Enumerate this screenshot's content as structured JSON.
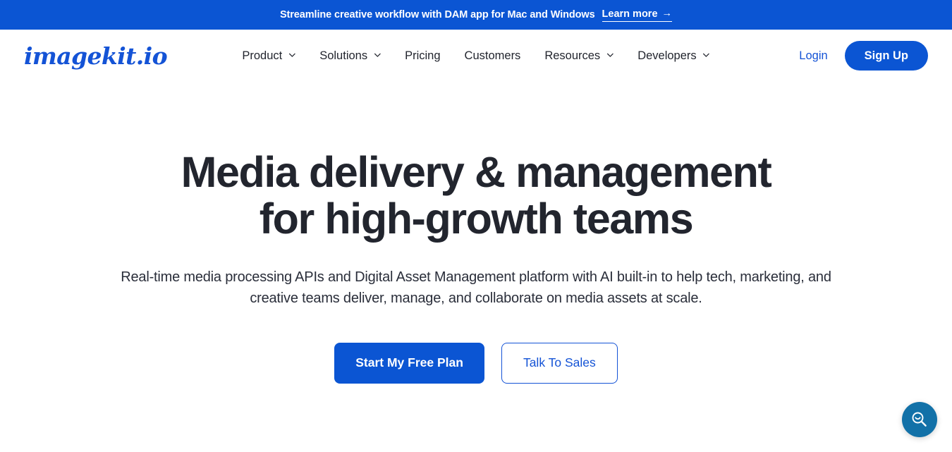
{
  "announcement": {
    "text": "Streamline creative workflow with DAM app for Mac and Windows",
    "link_label": "Learn more",
    "link_arrow": "→",
    "background_color": "#0b55d3"
  },
  "header": {
    "logo": "imagekit.io",
    "nav": [
      {
        "label": "Product",
        "icon": "chevron-down-icon",
        "has_dropdown": true
      },
      {
        "label": "Solutions",
        "icon": "chevron-down-icon",
        "has_dropdown": true
      },
      {
        "label": "Pricing",
        "icon": "",
        "has_dropdown": false
      },
      {
        "label": "Customers",
        "icon": "",
        "has_dropdown": false
      },
      {
        "label": "Resources",
        "icon": "chevron-down-icon",
        "has_dropdown": true
      },
      {
        "label": "Developers",
        "icon": "chevron-down-icon",
        "has_dropdown": true
      }
    ],
    "login_label": "Login",
    "signup_label": "Sign Up"
  },
  "hero": {
    "title": "Media delivery & management for high-growth teams",
    "subtitle": "Real-time media processing APIs and Digital Asset Management platform with AI built-in to help tech, marketing, and creative teams deliver, manage, and collaborate on media assets at scale.",
    "primary_cta": "Start My Free Plan",
    "secondary_cta": "Talk To Sales"
  },
  "floating": {
    "search_icon": "search-icon",
    "search_color": "#1271a8"
  },
  "theme": {
    "brand_blue": "#0b55d3",
    "link_blue": "#1453d6",
    "text_dark": "#22252e",
    "background": "#ffffff"
  }
}
